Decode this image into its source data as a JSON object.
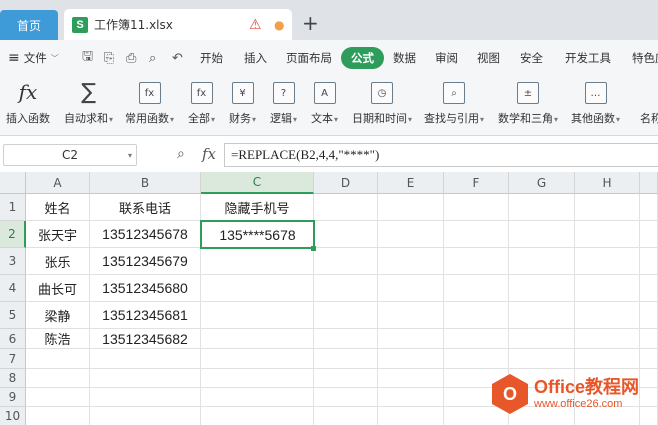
{
  "tabs": {
    "home": "首页",
    "document": "工作簿11.xlsx",
    "doc_icon_letter": "S"
  },
  "menu": {
    "file": "文件",
    "items": [
      "开始",
      "插入",
      "页面布局",
      "公式",
      "数据",
      "审阅",
      "视图",
      "安全",
      "开发工具",
      "特色应"
    ],
    "active": "公式"
  },
  "ribbon": {
    "buttons": [
      {
        "label": "插入函数",
        "icon": "fx-icon"
      },
      {
        "label": "自动求和",
        "icon": "sum-icon"
      },
      {
        "label": "常用函数",
        "icon": "common-func-icon"
      },
      {
        "label": "全部",
        "icon": "all-func-icon"
      },
      {
        "label": "财务",
        "icon": "finance-icon"
      },
      {
        "label": "逻辑",
        "icon": "logic-icon"
      },
      {
        "label": "文本",
        "icon": "text-func-icon"
      },
      {
        "label": "日期和时间",
        "icon": "datetime-icon"
      },
      {
        "label": "查找与引用",
        "icon": "lookup-icon"
      },
      {
        "label": "数学和三角",
        "icon": "math-icon"
      },
      {
        "label": "其他函数",
        "icon": "more-func-icon"
      },
      {
        "label": "名称",
        "icon": "name-icon"
      }
    ]
  },
  "formula_bar": {
    "name_box": "C2",
    "formula": "=REPLACE(B2,4,4,\"****\")"
  },
  "sheet": {
    "columns": [
      "A",
      "B",
      "C",
      "D",
      "E",
      "F",
      "G",
      "H"
    ],
    "rows": [
      "1",
      "2",
      "3",
      "4",
      "5",
      "6",
      "7",
      "8",
      "9",
      "10"
    ],
    "selected_column": "C",
    "selected_row": "2",
    "header": [
      "姓名",
      "联系电话",
      "隐藏手机号"
    ],
    "data": [
      [
        "张天宇",
        "13512345678",
        "135****5678"
      ],
      [
        "张乐",
        "13512345679",
        ""
      ],
      [
        "曲长可",
        "13512345680",
        ""
      ],
      [
        "梁静",
        "13512345681",
        ""
      ],
      [
        "陈浩",
        "13512345682",
        ""
      ]
    ]
  },
  "watermark": {
    "title": "Office教程网",
    "url": "www.office26.com",
    "logo_letter": "O"
  },
  "colors": {
    "accent": "#2e9d5c",
    "home_tab": "#3f9bd8",
    "watermark": "#e8572a"
  }
}
